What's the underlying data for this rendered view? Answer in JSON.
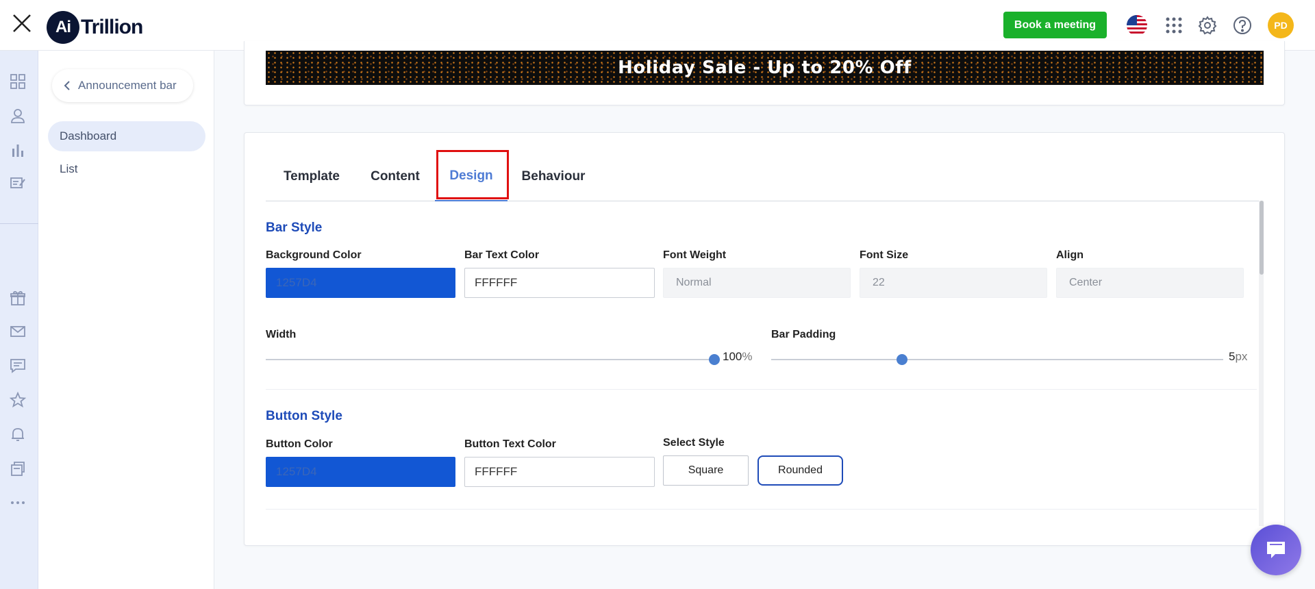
{
  "header": {
    "logo_mark": "Ai",
    "logo_text": "Trillion",
    "book_meeting_label": "Book a meeting",
    "avatar_initials": "PD",
    "brand_color": "#1ab12b"
  },
  "subnav": {
    "back_label": "Announcement bar",
    "items": [
      {
        "label": "Dashboard",
        "active": true
      },
      {
        "label": "List",
        "active": false
      }
    ]
  },
  "preview": {
    "banner_text": "Holiday Sale - Up to 20% Off"
  },
  "tabs": [
    {
      "label": "Template"
    },
    {
      "label": "Content"
    },
    {
      "label": "Design",
      "active": true
    },
    {
      "label": "Behaviour"
    }
  ],
  "bar_style": {
    "title": "Bar Style",
    "background_color_label": "Background Color",
    "background_color_value": "1257D4",
    "bar_text_color_label": "Bar Text Color",
    "bar_text_color_value": "FFFFFF",
    "font_weight_label": "Font Weight",
    "font_weight_value": "Normal",
    "font_size_label": "Font Size",
    "font_size_value": "22",
    "align_label": "Align",
    "align_value": "Center",
    "width_label": "Width",
    "width_value": "100",
    "width_unit": "%",
    "width_fraction": 1.0,
    "bar_padding_label": "Bar Padding",
    "bar_padding_value": "5",
    "bar_padding_unit": "px",
    "bar_padding_fraction": 0.29
  },
  "button_style": {
    "title": "Button Style",
    "button_color_label": "Button Color",
    "button_color_value": "1257D4",
    "button_text_color_label": "Button Text Color",
    "button_text_color_value": "FFFFFF",
    "select_style_label": "Select Style",
    "square_label": "Square",
    "rounded_label": "Rounded",
    "selected_style": "Rounded"
  },
  "colors": {
    "accent": "#4e7bd4",
    "section_title": "#1e4bb8",
    "swatch": "#1257D4"
  }
}
